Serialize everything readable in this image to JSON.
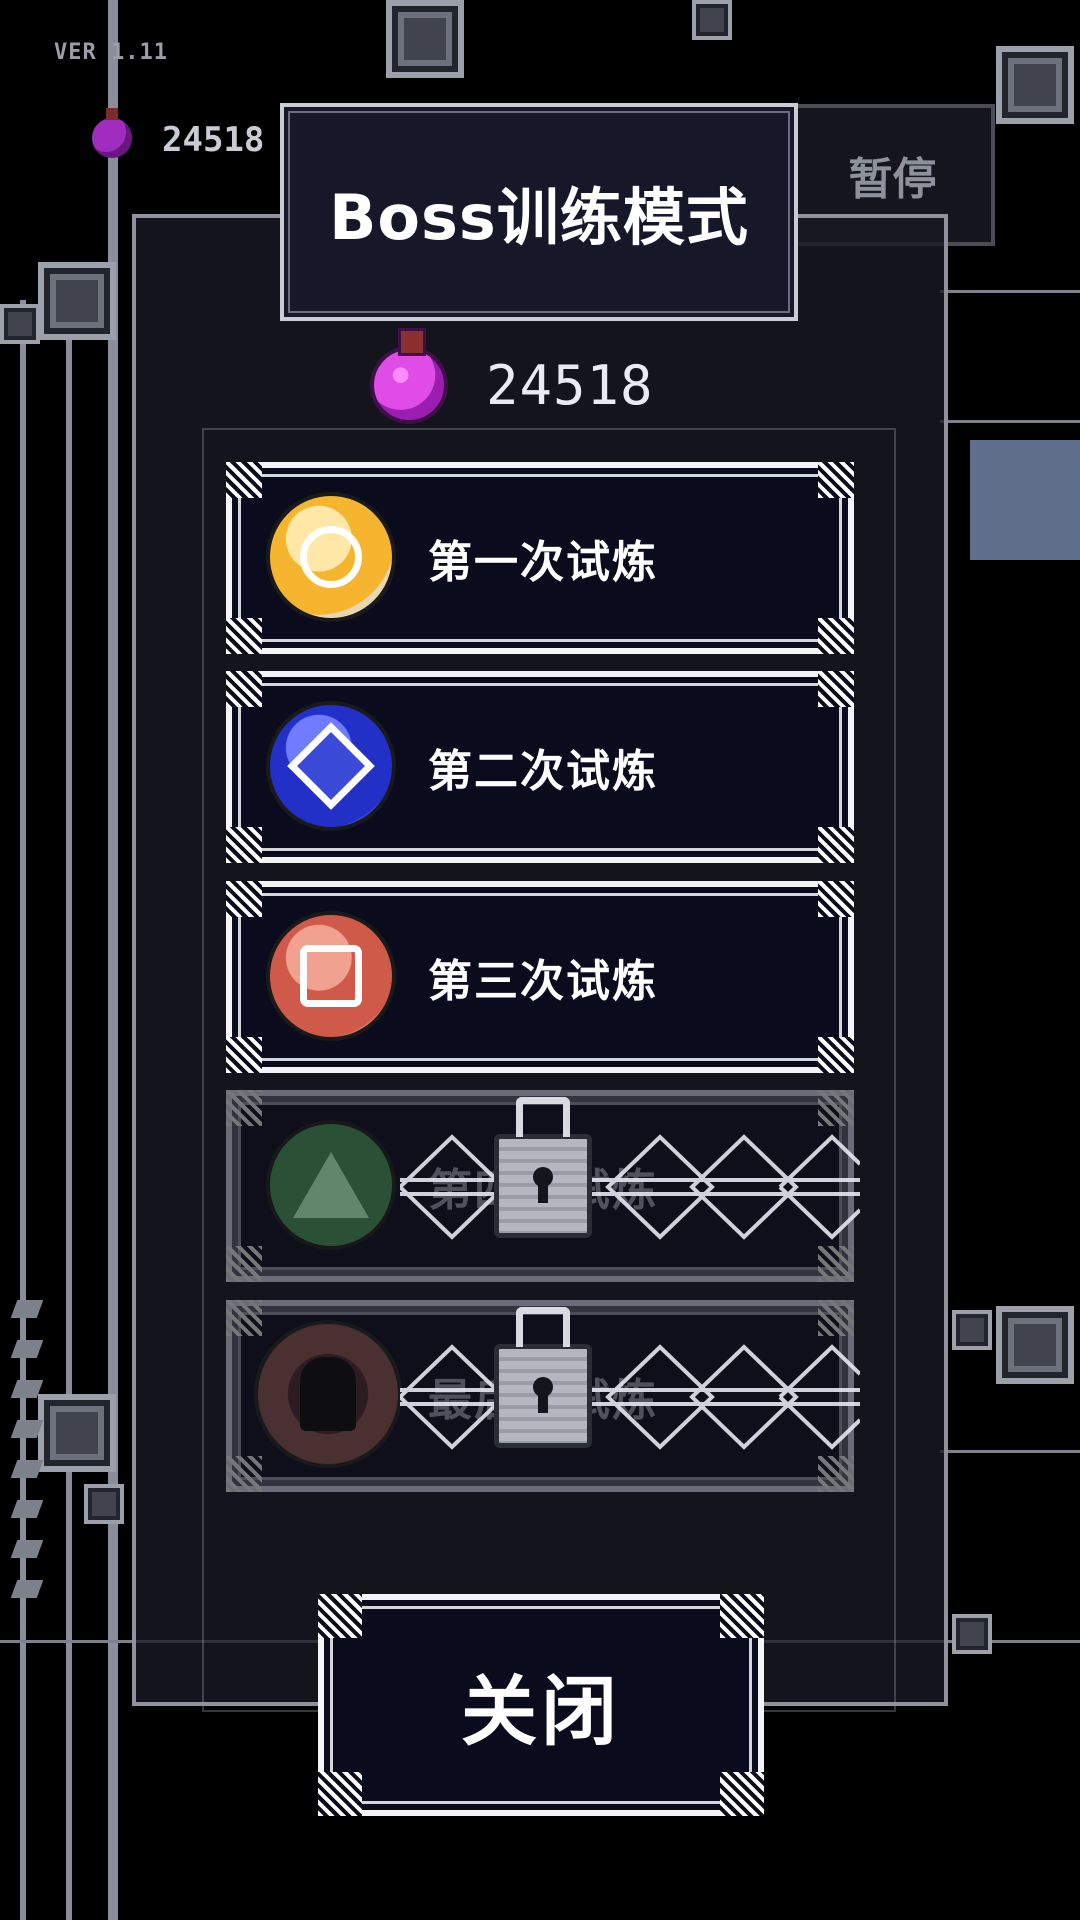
{
  "hud": {
    "version": "VER 1.11",
    "coins": "24518",
    "pause_label": "暂停"
  },
  "dialog": {
    "title": "Boss训练模式",
    "currency_value": "24518",
    "currency_icon": "potion-icon",
    "trials": [
      {
        "label": "第一次试炼",
        "locked": false,
        "medal": "gold-medal-icon"
      },
      {
        "label": "第二次试炼",
        "locked": false,
        "medal": "blue-medal-icon"
      },
      {
        "label": "第三次试炼",
        "locked": false,
        "medal": "red-medal-icon"
      },
      {
        "label": "第四次试炼",
        "locked": true,
        "medal": "green-medal-icon"
      },
      {
        "label": "最后的试炼",
        "locked": true,
        "medal": "dark-medal-icon"
      }
    ],
    "close_label": "关闭"
  },
  "colors": {
    "button_bg": "#0b0b1e",
    "button_border": "#f4f4f7",
    "panel_border": "#8f929d",
    "title_bg": "#161829"
  }
}
